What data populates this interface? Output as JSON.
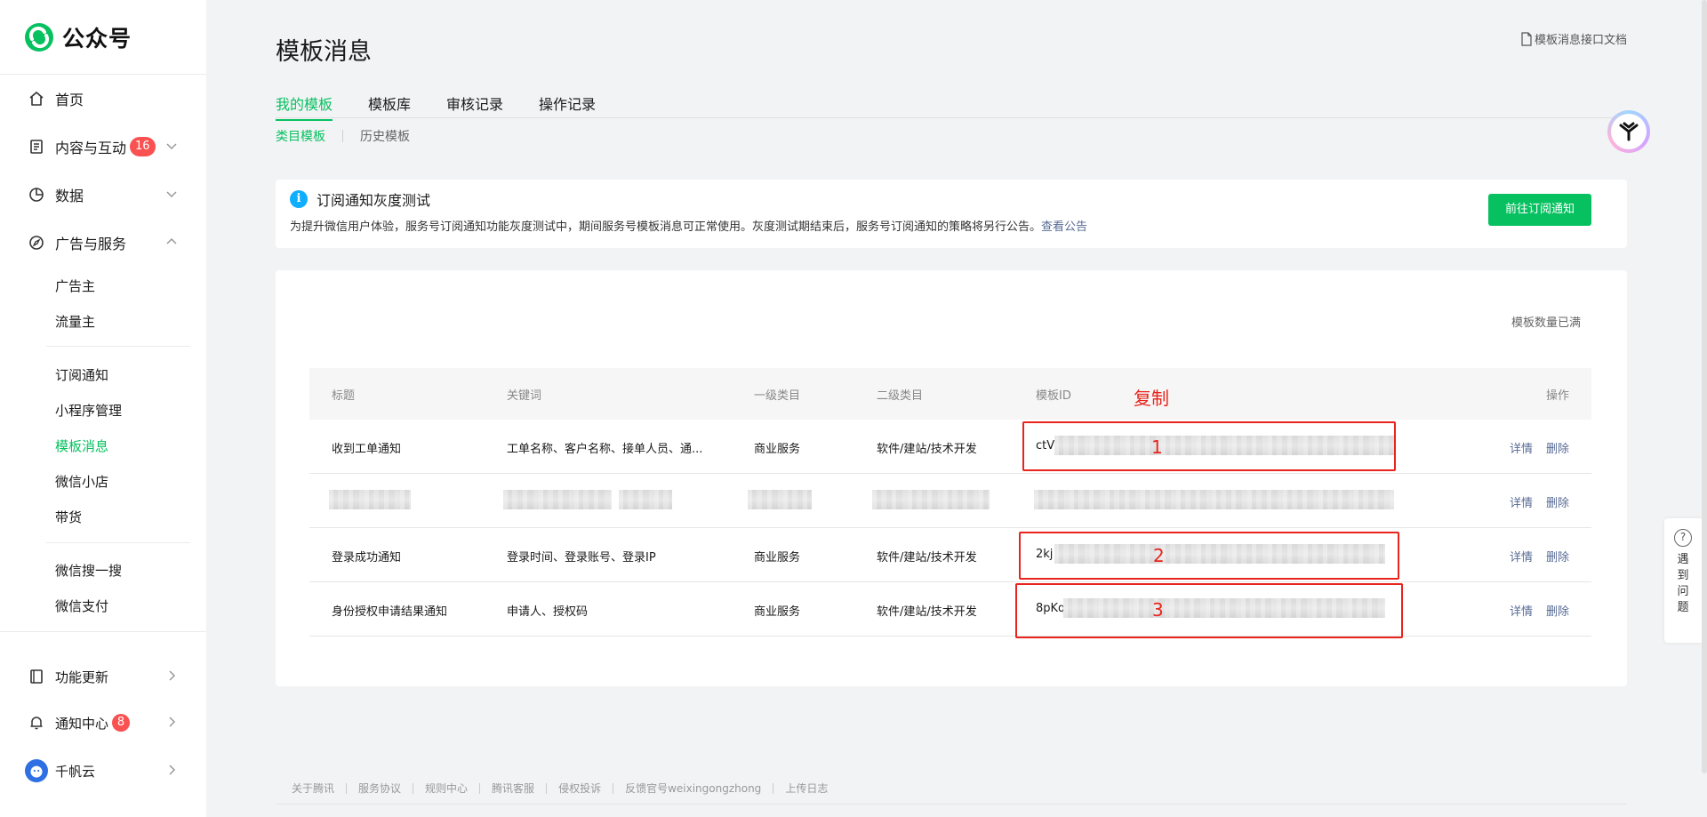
{
  "app": {
    "title": "公众号"
  },
  "sidebar": {
    "items": [
      {
        "label": "首页",
        "icon": "home-icon"
      },
      {
        "label": "内容与互动",
        "icon": "document-icon",
        "badge": "16"
      },
      {
        "label": "数据",
        "icon": "pie-chart-icon"
      },
      {
        "label": "广告与服务",
        "icon": "compass-icon"
      }
    ],
    "sub_ads": [
      "广告主",
      "流量主"
    ],
    "sub_services": [
      "订阅通知",
      "小程序管理",
      "模板消息",
      "微信小店",
      "带货"
    ],
    "sub_other": [
      "微信搜一搜",
      "微信支付"
    ],
    "bottom": [
      {
        "label": "功能更新",
        "icon": "book-icon"
      },
      {
        "label": "通知中心",
        "icon": "bell-icon",
        "badge": "8"
      },
      {
        "label": "千帆云",
        "icon": "avatar-icon"
      }
    ]
  },
  "header": {
    "title": "模板消息",
    "doc_link": "模板消息接口文档"
  },
  "tabs": [
    "我的模板",
    "模板库",
    "审核记录",
    "操作记录"
  ],
  "subtabs": [
    "类目模板",
    "历史模板"
  ],
  "notice": {
    "title": "订阅通知灰度测试",
    "body": "为提升微信用户体验，服务号订阅通知功能灰度测试中，期间服务号模板消息可正常使用。灰度测试期结束后，服务号订阅通知的策略将另行公告。",
    "link": "查看公告",
    "button": "前往订阅通知"
  },
  "table": {
    "quota_note": "模板数量已满",
    "headers": [
      "标题",
      "关键词",
      "一级类目",
      "二级类目",
      "模板ID",
      "操作"
    ],
    "rows": [
      {
        "title": "收到工单通知",
        "keywords": "工单名称、客户名称、接单人员、通...",
        "cat1": "商业服务",
        "cat2": "软件/建站/技术开发",
        "id": "ctV",
        "detail": "详情",
        "delete": "删除"
      },
      {
        "title": "",
        "keywords": "",
        "cat1": "",
        "cat2": "",
        "id": "",
        "detail": "详情",
        "delete": "删除"
      },
      {
        "title": "登录成功通知",
        "keywords": "登录时间、登录账号、登录IP",
        "cat1": "商业服务",
        "cat2": "软件/建站/技术开发",
        "id": "2kj",
        "detail": "详情",
        "delete": "删除"
      },
      {
        "title": "身份授权申请结果通知",
        "keywords": "申请人、授权码",
        "cat1": "商业服务",
        "cat2": "软件/建站/技术开发",
        "id": "8pKq",
        "detail": "详情",
        "delete": "删除"
      }
    ]
  },
  "annotations": {
    "copy_label": "复制",
    "numbers": [
      "1",
      "2",
      "3"
    ],
    "color": "#e8241c"
  },
  "help": {
    "label": "遇到问题"
  },
  "footer": {
    "links": [
      "关于腾讯",
      "服务协议",
      "规则中心",
      "腾讯客服",
      "侵权投诉",
      "反馈官号weixingongzhong",
      "上传日志"
    ]
  },
  "colors": {
    "brand": "#07c160",
    "link": "#576b95",
    "badge": "#fa5151",
    "info": "#10aeff"
  }
}
